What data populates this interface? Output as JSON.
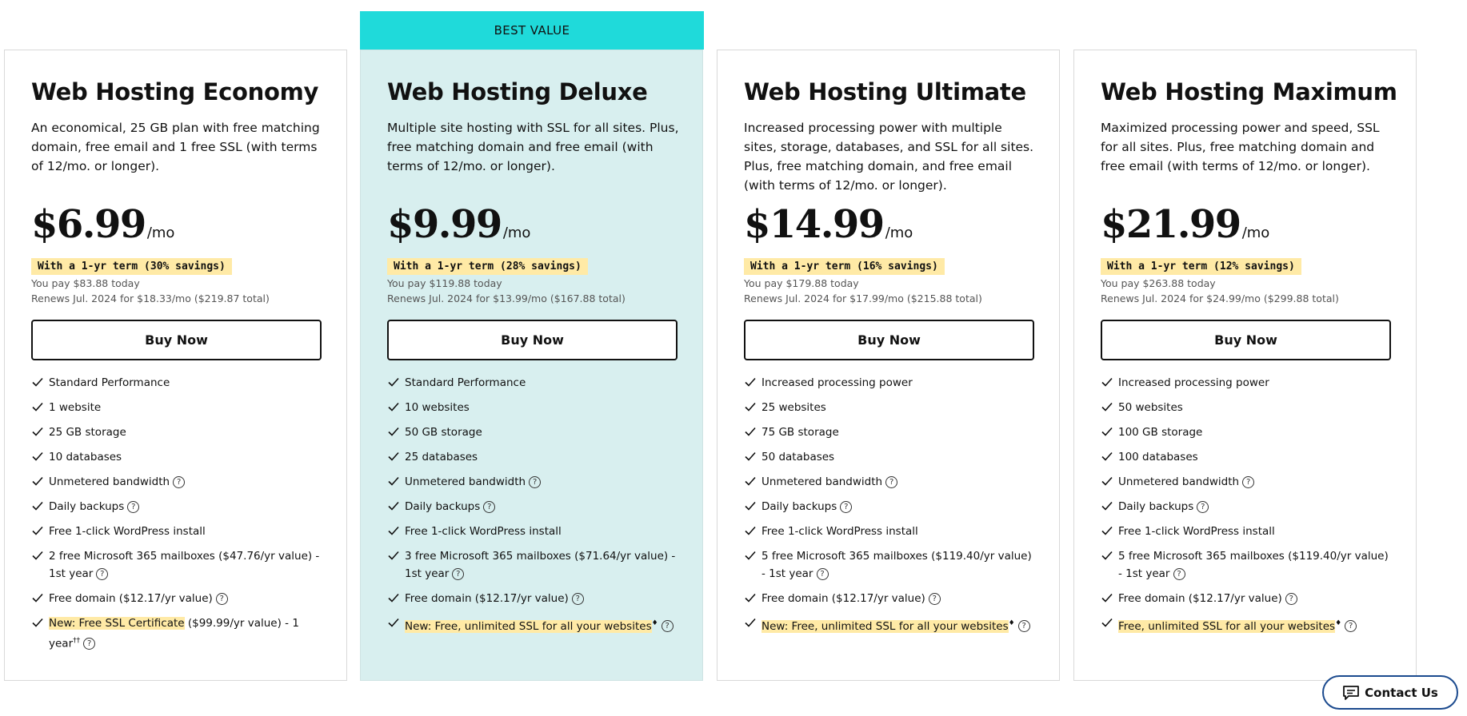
{
  "ribbon": "BEST VALUE",
  "plans": [
    {
      "title": "Web Hosting Economy",
      "desc": "An economical, 25 GB plan with free matching domain, free email and 1 free SSL (with terms of 12/mo. or longer).",
      "price": "$6.99",
      "per": "/mo",
      "badge": "With a 1-yr term (30% savings)",
      "pay": "You pay $83.88 today",
      "renew": "Renews Jul. 2024 for $18.33/mo ($219.87 total)",
      "buy": "Buy Now",
      "f1": "Standard Performance",
      "f2": "1 website",
      "f3": "25 GB storage",
      "f4": "10 databases",
      "f5": "Unmetered bandwidth",
      "f6": "Daily backups",
      "f7": "Free 1-click WordPress install",
      "f8": "2 free Microsoft 365 mailboxes ($47.76/yr value) - 1st year",
      "f9": "Free domain ($12.17/yr value)",
      "f10_hl": "New: Free SSL Certificate",
      "f10_rest": " ($99.99/yr value) - 1 year",
      "f10_sup": "††"
    },
    {
      "title": "Web Hosting Deluxe",
      "desc": "Multiple site hosting with SSL for all sites. Plus, free matching domain and free email (with terms of 12/mo. or longer).",
      "price": "$9.99",
      "per": "/mo",
      "badge": "With a 1-yr term (28% savings)",
      "pay": "You pay $119.88 today",
      "renew": "Renews Jul. 2024 for $13.99/mo ($167.88 total)",
      "buy": "Buy Now",
      "f1": "Standard Performance",
      "f2": "10 websites",
      "f3": "50 GB storage",
      "f4": "25 databases",
      "f5": "Unmetered bandwidth",
      "f6": "Daily backups",
      "f7": "Free 1-click WordPress install",
      "f8": "3 free Microsoft 365 mailboxes ($71.64/yr value) - 1st year",
      "f9": "Free domain ($12.17/yr value)",
      "f10_hl": "New: Free, unlimited SSL for all your websites",
      "f10_sup": "♦"
    },
    {
      "title": "Web Hosting Ultimate",
      "desc": "Increased processing power with multiple sites, storage, databases, and SSL for all sites. Plus, free matching domain, and free email (with terms of 12/mo. or longer).",
      "price": "$14.99",
      "per": "/mo",
      "badge": "With a 1-yr term (16% savings)",
      "pay": "You pay $179.88 today",
      "renew": "Renews Jul. 2024 for $17.99/mo ($215.88 total)",
      "buy": "Buy Now",
      "f1": "Increased processing power",
      "f2": "25 websites",
      "f3": "75 GB storage",
      "f4": "50 databases",
      "f5": "Unmetered bandwidth",
      "f6": "Daily backups",
      "f7": "Free 1-click WordPress install",
      "f8": "5 free Microsoft 365 mailboxes ($119.40/yr value) - 1st year",
      "f9": "Free domain ($12.17/yr value)",
      "f10_hl": "New: Free, unlimited SSL for all your websites",
      "f10_sup": "♦"
    },
    {
      "title": "Web Hosting Maximum",
      "desc": "Maximized processing power and speed, SSL for all sites. Plus, free matching domain and free email (with terms of 12/mo. or longer).",
      "price": "$21.99",
      "per": "/mo",
      "badge": "With a 1-yr term (12% savings)",
      "pay": "You pay $263.88 today",
      "renew": "Renews Jul. 2024 for $24.99/mo ($299.88 total)",
      "buy": "Buy Now",
      "f1": "Increased processing power",
      "f2": "50 websites",
      "f3": "100 GB storage",
      "f4": "100 databases",
      "f5": "Unmetered bandwidth",
      "f6": "Daily backups",
      "f7": "Free 1-click WordPress install",
      "f8": "5 free Microsoft 365 mailboxes ($119.40/yr value) - 1st year",
      "f9": "Free domain ($12.17/yr value)",
      "f10_hl": "Free, unlimited SSL for all your websites",
      "f10_sup": "♦"
    }
  ],
  "help_glyph": "?",
  "contact": "Contact Us",
  "colors": {
    "ribbon": "#1fdada",
    "featured_bg": "#d8efef",
    "badge": "#ffeaa6",
    "contact_border": "#1b4a8e"
  }
}
